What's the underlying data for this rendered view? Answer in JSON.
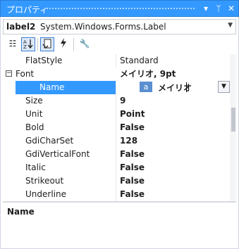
{
  "window": {
    "title": "プロパティ"
  },
  "object_selector": {
    "name": "label2",
    "type": "System.Windows.Forms.Label"
  },
  "toolbar": {
    "categorized": "categorized-icon",
    "alphabetical": "alphabetical-icon",
    "properties": "properties-icon",
    "events": "events-icon",
    "property_pages": "wrench-icon"
  },
  "properties": {
    "rows": [
      {
        "label": "FlatStyle",
        "value": "Standard",
        "bold": false
      },
      {
        "label": "Font",
        "value": "メイリオ, 9pt",
        "bold": true,
        "category": true,
        "expanded": true
      },
      {
        "label": "Name",
        "value": "メイリオ",
        "bold": true,
        "selected": true
      },
      {
        "label": "Size",
        "value": "9",
        "bold": true
      },
      {
        "label": "Unit",
        "value": "Point",
        "bold": true
      },
      {
        "label": "Bold",
        "value": "False",
        "bold": true
      },
      {
        "label": "GdiCharSet",
        "value": "128",
        "bold": true
      },
      {
        "label": "GdiVerticalFont",
        "value": "False",
        "bold": true
      },
      {
        "label": "Italic",
        "value": "False",
        "bold": true
      },
      {
        "label": "Strikeout",
        "value": "False",
        "bold": true
      },
      {
        "label": "Underline",
        "value": "False",
        "bold": true
      }
    ],
    "editor_chip": "a"
  },
  "description": {
    "title": "Name"
  }
}
